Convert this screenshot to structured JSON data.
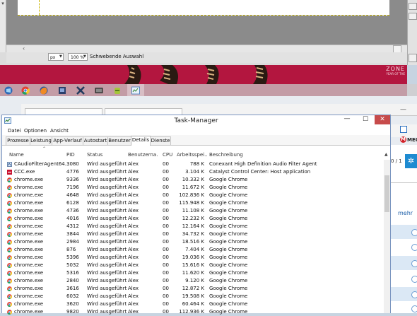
{
  "gimp": {
    "unit": "px",
    "zoom": "100 %",
    "status": "Schwebende Auswahl"
  },
  "wallpaper": {
    "logo": "ZONE",
    "sub": "YEAR OF THE"
  },
  "taskbar": {
    "items": [
      "windows-icon",
      "chrome-icon",
      "firefox-icon",
      "gimp-icon",
      "tools-icon",
      "media-icon",
      "android-icon",
      "taskmanager-icon"
    ]
  },
  "browser_bg": {
    "pager": "0 / 1",
    "mega_label": "MEGA",
    "more_link": "mehr"
  },
  "taskmanager": {
    "title": "Task-Manager",
    "menu": [
      "Datei",
      "Optionen",
      "Ansicht"
    ],
    "tabs": [
      "Prozesse",
      "Leistung",
      "App-Verlauf",
      "Autostart",
      "Benutzer",
      "Details",
      "Dienste"
    ],
    "active_tab": "Details",
    "columns": [
      "Name",
      "PID",
      "Status",
      "Benutzerna...",
      "CPU",
      "Arbeitsspei...",
      "Beschreibung"
    ],
    "rows": [
      {
        "icon": "audio",
        "name": "CAudioFilterAgent64...",
        "pid": "3080",
        "status": "Wird ausgeführt",
        "user": "Alex",
        "cpu": "00",
        "mem": "788 K",
        "desc": "Conexant High Definition Audio Filter Agent"
      },
      {
        "icon": "ccc",
        "name": "CCC.exe",
        "pid": "4776",
        "status": "Wird ausgeführt",
        "user": "Alex",
        "cpu": "00",
        "mem": "3.104 K",
        "desc": "Catalyst Control Center: Host application"
      },
      {
        "icon": "chrome",
        "name": "chrome.exe",
        "pid": "9336",
        "status": "Wird ausgeführt",
        "user": "Alex",
        "cpu": "00",
        "mem": "10.332 K",
        "desc": "Google Chrome"
      },
      {
        "icon": "chrome",
        "name": "chrome.exe",
        "pid": "7196",
        "status": "Wird ausgeführt",
        "user": "Alex",
        "cpu": "00",
        "mem": "11.672 K",
        "desc": "Google Chrome"
      },
      {
        "icon": "chrome",
        "name": "chrome.exe",
        "pid": "4648",
        "status": "Wird ausgeführt",
        "user": "Alex",
        "cpu": "00",
        "mem": "102.836 K",
        "desc": "Google Chrome"
      },
      {
        "icon": "chrome",
        "name": "chrome.exe",
        "pid": "6128",
        "status": "Wird ausgeführt",
        "user": "Alex",
        "cpu": "00",
        "mem": "115.948 K",
        "desc": "Google Chrome"
      },
      {
        "icon": "chrome",
        "name": "chrome.exe",
        "pid": "4736",
        "status": "Wird ausgeführt",
        "user": "Alex",
        "cpu": "00",
        "mem": "11.108 K",
        "desc": "Google Chrome"
      },
      {
        "icon": "chrome",
        "name": "chrome.exe",
        "pid": "4016",
        "status": "Wird ausgeführt",
        "user": "Alex",
        "cpu": "00",
        "mem": "12.232 K",
        "desc": "Google Chrome"
      },
      {
        "icon": "chrome",
        "name": "chrome.exe",
        "pid": "4312",
        "status": "Wird ausgeführt",
        "user": "Alex",
        "cpu": "00",
        "mem": "12.164 K",
        "desc": "Google Chrome"
      },
      {
        "icon": "chrome",
        "name": "chrome.exe",
        "pid": "3844",
        "status": "Wird ausgeführt",
        "user": "Alex",
        "cpu": "00",
        "mem": "34.732 K",
        "desc": "Google Chrome"
      },
      {
        "icon": "chrome",
        "name": "chrome.exe",
        "pid": "2984",
        "status": "Wird ausgeführt",
        "user": "Alex",
        "cpu": "00",
        "mem": "18.516 K",
        "desc": "Google Chrome"
      },
      {
        "icon": "chrome",
        "name": "chrome.exe",
        "pid": "876",
        "status": "Wird ausgeführt",
        "user": "Alex",
        "cpu": "00",
        "mem": "7.404 K",
        "desc": "Google Chrome"
      },
      {
        "icon": "chrome",
        "name": "chrome.exe",
        "pid": "5396",
        "status": "Wird ausgeführt",
        "user": "Alex",
        "cpu": "00",
        "mem": "19.036 K",
        "desc": "Google Chrome"
      },
      {
        "icon": "chrome",
        "name": "chrome.exe",
        "pid": "5032",
        "status": "Wird ausgeführt",
        "user": "Alex",
        "cpu": "00",
        "mem": "15.616 K",
        "desc": "Google Chrome"
      },
      {
        "icon": "chrome",
        "name": "chrome.exe",
        "pid": "5316",
        "status": "Wird ausgeführt",
        "user": "Alex",
        "cpu": "00",
        "mem": "11.620 K",
        "desc": "Google Chrome"
      },
      {
        "icon": "chrome",
        "name": "chrome.exe",
        "pid": "2840",
        "status": "Wird ausgeführt",
        "user": "Alex",
        "cpu": "00",
        "mem": "9.120 K",
        "desc": "Google Chrome"
      },
      {
        "icon": "chrome",
        "name": "chrome.exe",
        "pid": "3616",
        "status": "Wird ausgeführt",
        "user": "Alex",
        "cpu": "00",
        "mem": "12.872 K",
        "desc": "Google Chrome"
      },
      {
        "icon": "chrome",
        "name": "chrome.exe",
        "pid": "6032",
        "status": "Wird ausgeführt",
        "user": "Alex",
        "cpu": "00",
        "mem": "19.508 K",
        "desc": "Google Chrome"
      },
      {
        "icon": "chrome",
        "name": "chrome.exe",
        "pid": "3620",
        "status": "Wird ausgeführt",
        "user": "Alex",
        "cpu": "00",
        "mem": "60.464 K",
        "desc": "Google Chrome"
      },
      {
        "icon": "chrome",
        "name": "chrome.exe",
        "pid": "9820",
        "status": "Wird ausgeführt",
        "user": "Alex",
        "cpu": "00",
        "mem": "112.936 K",
        "desc": "Google Chrome"
      }
    ]
  }
}
